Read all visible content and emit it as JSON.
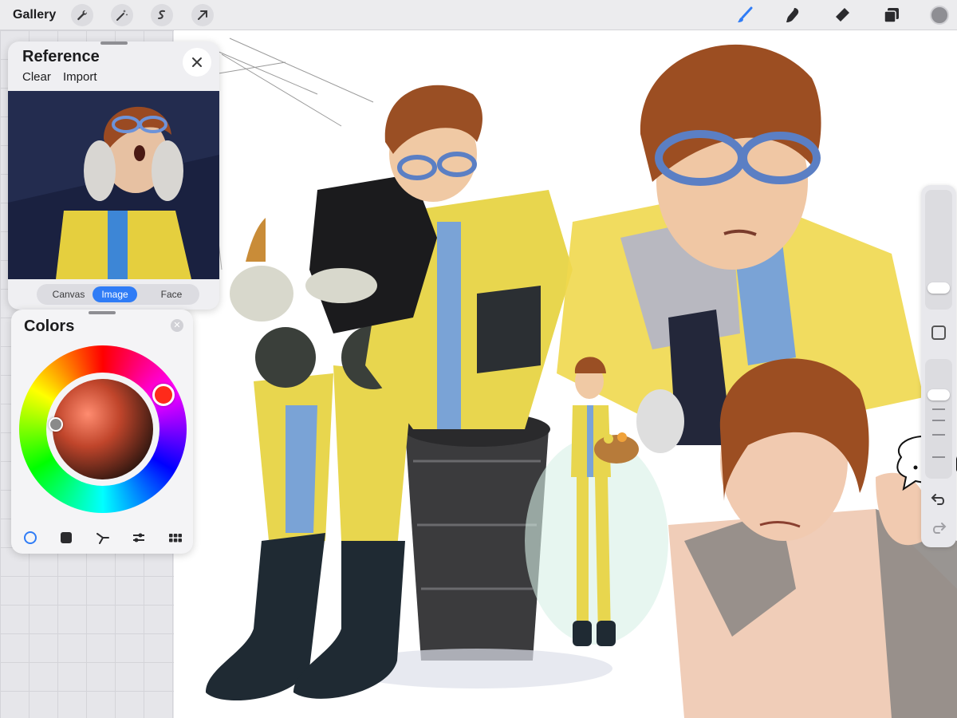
{
  "toolbar": {
    "gallery_label": "Gallery",
    "left_tools": [
      "wrench-icon",
      "magic-wand-icon",
      "selection-icon",
      "transform-arrow-icon"
    ],
    "right_tools": [
      "brush-icon",
      "smudge-icon",
      "eraser-icon",
      "layers-icon"
    ],
    "current_color": "#8e8e93",
    "brush_color": "#2f7cf6"
  },
  "reference": {
    "title": "Reference",
    "clear_label": "Clear",
    "import_label": "Import",
    "tabs": [
      {
        "label": "Canvas",
        "active": false
      },
      {
        "label": "Image",
        "active": true
      },
      {
        "label": "Face",
        "active": false
      }
    ]
  },
  "colors": {
    "title": "Colors",
    "hue_color": "#ff2a1a",
    "modes": [
      "disc-mode-icon",
      "classic-mode-icon",
      "harmony-mode-icon",
      "value-mode-icon",
      "palettes-mode-icon"
    ]
  }
}
